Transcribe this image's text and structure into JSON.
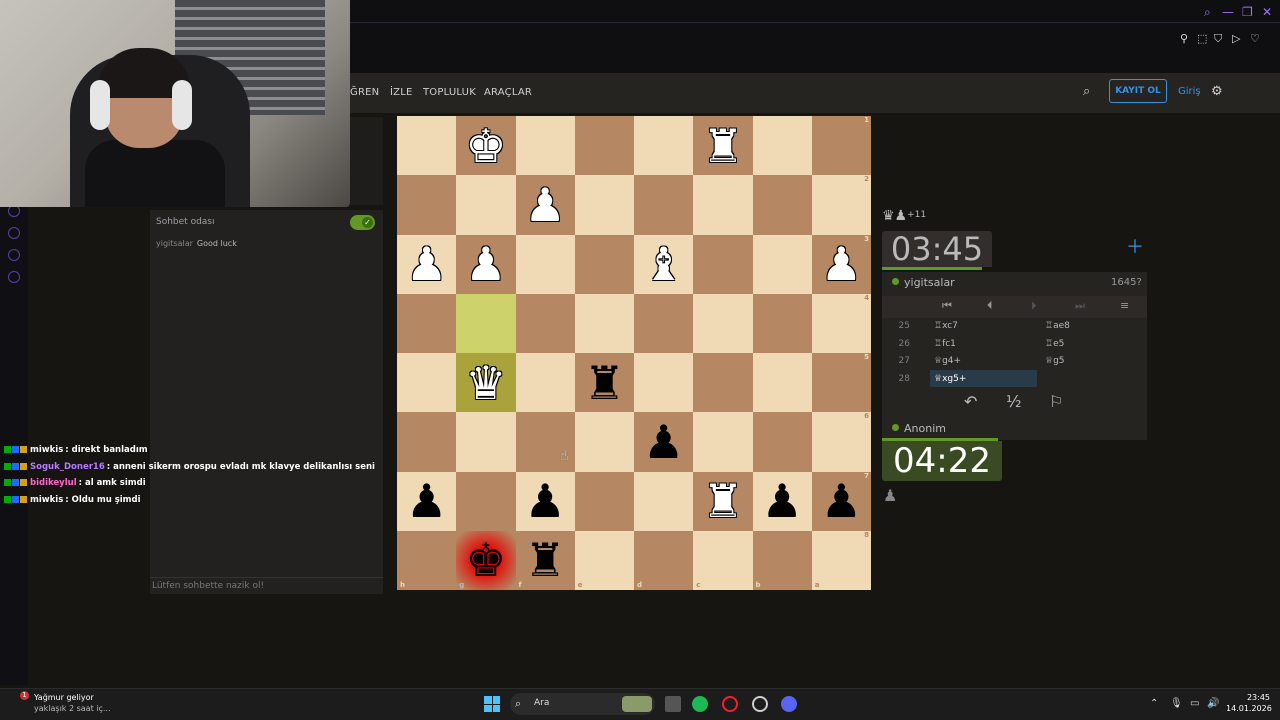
{
  "site_nav": {
    "items": [
      "ĞREN",
      "İZLE",
      "TOPLULUK",
      "ARAÇLAR"
    ],
    "signup_label": "KAYIT OL",
    "login_label": "Giriş"
  },
  "chat": {
    "title": "Sohbet odası",
    "messages": [
      {
        "user": "yigitsalar",
        "text": "Good luck"
      }
    ],
    "input_placeholder": "Lütfen sohbette nazik ol!"
  },
  "stream_chat": [
    {
      "user": "miwkis",
      "text": ": direkt banladım",
      "color": "#ffffff"
    },
    {
      "user": "Soguk_Doner16",
      "text": ": anneni sikerm orospu evladı mk klavye delikanlısı seni",
      "color": "#b47cff"
    },
    {
      "user": "bidikeylul",
      "text": ": al amk simdi",
      "color": "#ff66cc"
    },
    {
      "user": "miwkis",
      "text": ": Oldu mu şimdi",
      "color": "#ffffff"
    }
  ],
  "board": {
    "rows": [
      [
        "",
        "wK",
        "",
        "",
        "",
        "wR",
        "",
        ""
      ],
      [
        "",
        "",
        "wP",
        "",
        "",
        "",
        "",
        ""
      ],
      [
        "wP",
        "wP",
        "",
        "",
        "wB",
        "",
        "",
        "wP"
      ],
      [
        "",
        "hl",
        "",
        "",
        "",
        "",
        "",
        ""
      ],
      [
        "",
        "wQ*",
        "",
        "bR",
        "",
        "",
        "",
        ""
      ],
      [
        "",
        "",
        "",
        "",
        "bP",
        "",
        "",
        ""
      ],
      [
        "bP",
        "",
        "bP",
        "",
        "",
        "wR",
        "bP",
        "bP"
      ],
      [
        "",
        "bK!",
        "bR",
        "",
        "",
        "",
        "",
        ""
      ]
    ],
    "ranks": [
      "1",
      "2",
      "3",
      "4",
      "5",
      "6",
      "7",
      "8"
    ],
    "files": [
      "h",
      "g",
      "f",
      "e",
      "d",
      "c",
      "b",
      "a"
    ]
  },
  "right_panel": {
    "material": {
      "pieces": "♛♟",
      "diff": "+11"
    },
    "clock_top": "03:45",
    "player_top": {
      "name": "yigitsalar",
      "rating": "1645?"
    },
    "moves": [
      {
        "num": "25",
        "white": "♖xc7",
        "black": "♖ae8"
      },
      {
        "num": "26",
        "white": "♖fc1",
        "black": "♖e5"
      },
      {
        "num": "27",
        "white": "♕g4+",
        "black": "♕g5"
      },
      {
        "num": "28",
        "white": "♕xg5+",
        "black": ""
      }
    ],
    "player_bottom": {
      "name": "Anonim"
    },
    "clock_bottom": "04:22",
    "half": "½"
  },
  "taskbar": {
    "weather_title": "Yağmur geliyor",
    "weather_sub": "yaklaşık 2 saat iç...",
    "weather_badge": "1",
    "search_label": "Ara",
    "time": "23:45",
    "date": "14.01.2026"
  },
  "colors": {
    "board_light": "#f0d9b5",
    "board_dark": "#b58863",
    "accent_blue": "#3692e7",
    "accent_green": "#629924"
  }
}
